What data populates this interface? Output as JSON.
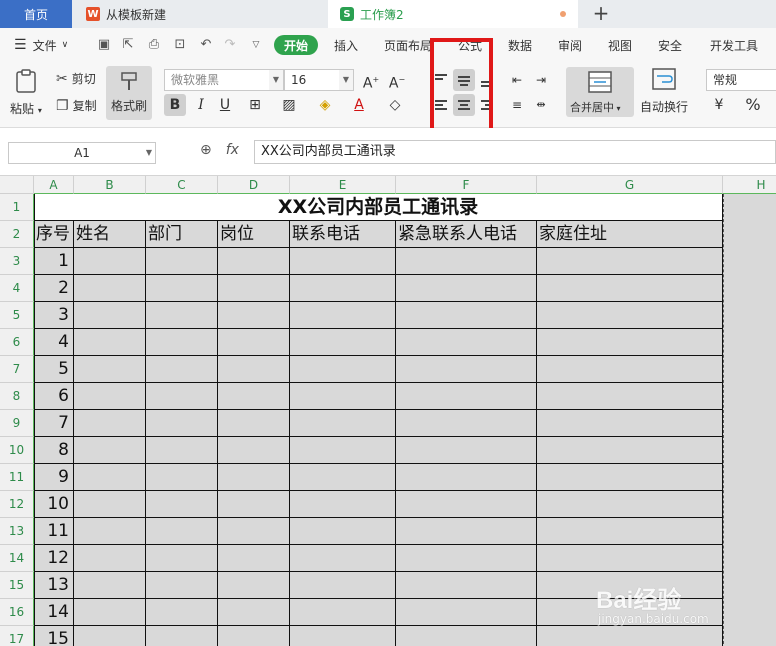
{
  "tabs": {
    "home": "首页",
    "template": "从模板新建",
    "template_icon": "W",
    "book": "工作簿2",
    "book_icon": "S",
    "new_tab": "+"
  },
  "menu": {
    "file": "文件",
    "items": [
      "开始",
      "插入",
      "页面布局",
      "公式",
      "数据",
      "审阅",
      "视图",
      "安全",
      "开发工具"
    ]
  },
  "ribbon": {
    "paste": "粘贴",
    "cut": "剪切",
    "copy": "复制",
    "format_painter": "格式刷",
    "font_name": "微软雅黑",
    "font_size": "16",
    "bold": "B",
    "italic": "I",
    "underline": "U",
    "grow_font": "A",
    "shrink_font": "A",
    "merge_center": "合并居中",
    "auto_wrap": "自动换行",
    "number_format": "常规",
    "percent": "%",
    "currency": "¥"
  },
  "formula_bar": {
    "name_box": "A1",
    "fx": "fx",
    "zoom_icon": "search-zoom-icon",
    "value": "XX公司内部员工通讯录"
  },
  "sheet": {
    "columns": [
      "A",
      "B",
      "C",
      "D",
      "E",
      "F",
      "G",
      "H"
    ],
    "rows": [
      "1",
      "2",
      "3",
      "4",
      "5",
      "6",
      "7",
      "8",
      "9",
      "10",
      "11",
      "12",
      "13",
      "14",
      "15",
      "16",
      "17"
    ],
    "title": "XX公司内部员工通讯录",
    "headers": [
      "序号",
      "姓名",
      "部门",
      "岗位",
      "联系电话",
      "紧急联系人电话",
      "家庭住址"
    ],
    "serials": [
      "1",
      "2",
      "3",
      "4",
      "5",
      "6",
      "7",
      "8",
      "9",
      "10",
      "11",
      "12",
      "13",
      "14",
      "15"
    ]
  },
  "watermark": {
    "main": "Bai经验",
    "sub": "jingyan.baidu.com"
  },
  "colors": {
    "home_tab": "#3b6fc6",
    "start_tab": "#2fa34d",
    "highlight_box": "#e01818",
    "cell_bg": "#d9d9d9",
    "header_green": "#2e8b4a"
  }
}
